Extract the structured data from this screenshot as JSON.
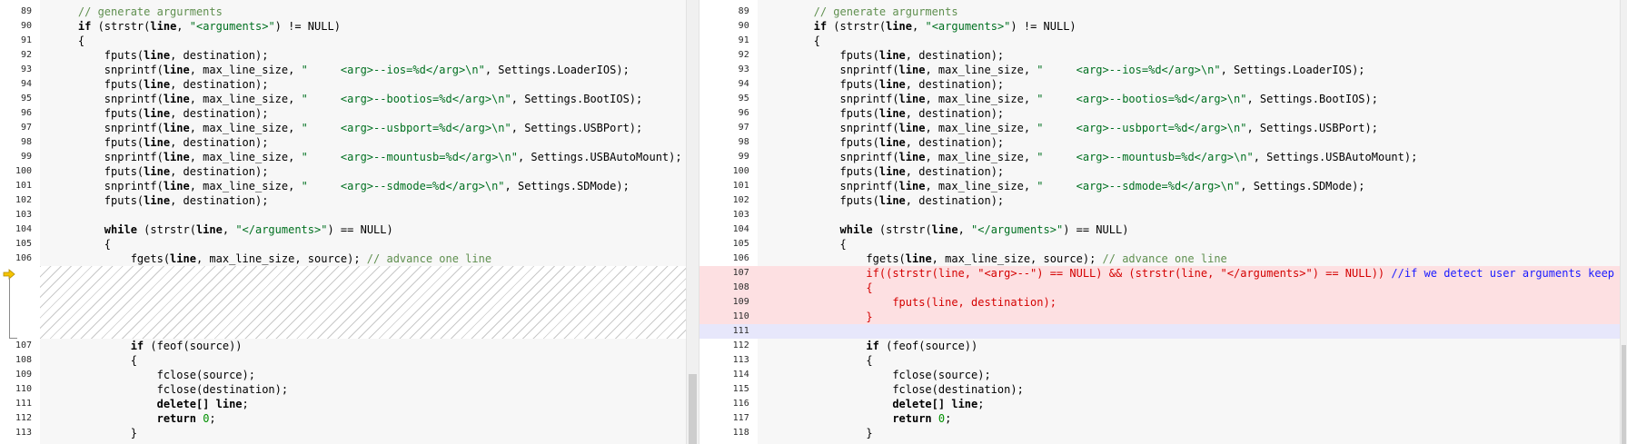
{
  "left": {
    "lines_top": [
      {
        "n": "89",
        "segs": [
          [
            "c",
            "    // generate argurments"
          ]
        ]
      },
      {
        "n": "90",
        "segs": [
          [
            "b",
            "    if"
          ],
          [
            "p",
            " (strstr("
          ],
          [
            "b",
            "line"
          ],
          [
            "p",
            ", "
          ],
          [
            "s",
            "\"<arguments>\""
          ],
          [
            "p",
            ") != NULL)"
          ]
        ]
      },
      {
        "n": "91",
        "segs": [
          [
            "p",
            "    {"
          ]
        ]
      },
      {
        "n": "92",
        "segs": [
          [
            "p",
            "        fputs("
          ],
          [
            "b",
            "line"
          ],
          [
            "p",
            ", destination);"
          ]
        ]
      },
      {
        "n": "93",
        "segs": [
          [
            "p",
            "        snprintf("
          ],
          [
            "b",
            "line"
          ],
          [
            "p",
            ", max_line_size, "
          ],
          [
            "s",
            "\"     <arg>--ios=%d</arg>\\n\""
          ],
          [
            "p",
            ", Settings.LoaderIOS);"
          ]
        ]
      },
      {
        "n": "94",
        "segs": [
          [
            "p",
            "        fputs("
          ],
          [
            "b",
            "line"
          ],
          [
            "p",
            ", destination);"
          ]
        ]
      },
      {
        "n": "95",
        "segs": [
          [
            "p",
            "        snprintf("
          ],
          [
            "b",
            "line"
          ],
          [
            "p",
            ", max_line_size, "
          ],
          [
            "s",
            "\"     <arg>--bootios=%d</arg>\\n\""
          ],
          [
            "p",
            ", Settings.BootIOS);"
          ]
        ]
      },
      {
        "n": "96",
        "segs": [
          [
            "p",
            "        fputs("
          ],
          [
            "b",
            "line"
          ],
          [
            "p",
            ", destination);"
          ]
        ]
      },
      {
        "n": "97",
        "segs": [
          [
            "p",
            "        snprintf("
          ],
          [
            "b",
            "line"
          ],
          [
            "p",
            ", max_line_size, "
          ],
          [
            "s",
            "\"     <arg>--usbport=%d</arg>\\n\""
          ],
          [
            "p",
            ", Settings.USBPort);"
          ]
        ]
      },
      {
        "n": "98",
        "segs": [
          [
            "p",
            "        fputs("
          ],
          [
            "b",
            "line"
          ],
          [
            "p",
            ", destination);"
          ]
        ]
      },
      {
        "n": "99",
        "segs": [
          [
            "p",
            "        snprintf("
          ],
          [
            "b",
            "line"
          ],
          [
            "p",
            ", max_line_size, "
          ],
          [
            "s",
            "\"     <arg>--mountusb=%d</arg>\\n\""
          ],
          [
            "p",
            ", Settings.USBAutoMount);"
          ]
        ]
      },
      {
        "n": "100",
        "segs": [
          [
            "p",
            "        fputs("
          ],
          [
            "b",
            "line"
          ],
          [
            "p",
            ", destination);"
          ]
        ]
      },
      {
        "n": "101",
        "segs": [
          [
            "p",
            "        snprintf("
          ],
          [
            "b",
            "line"
          ],
          [
            "p",
            ", max_line_size, "
          ],
          [
            "s",
            "\"     <arg>--sdmode=%d</arg>\\n\""
          ],
          [
            "p",
            ", Settings.SDMode);"
          ]
        ]
      },
      {
        "n": "102",
        "segs": [
          [
            "p",
            "        fputs("
          ],
          [
            "b",
            "line"
          ],
          [
            "p",
            ", destination);"
          ]
        ]
      },
      {
        "n": "103",
        "segs": [
          [
            "p",
            ""
          ]
        ]
      },
      {
        "n": "104",
        "segs": [
          [
            "b",
            "        while"
          ],
          [
            "p",
            " (strstr("
          ],
          [
            "b",
            "line"
          ],
          [
            "p",
            ", "
          ],
          [
            "s",
            "\"</arguments>\""
          ],
          [
            "p",
            ") == NULL)"
          ]
        ]
      },
      {
        "n": "105",
        "segs": [
          [
            "p",
            "        {"
          ]
        ]
      },
      {
        "n": "106",
        "segs": [
          [
            "p",
            "            fgets("
          ],
          [
            "b",
            "line"
          ],
          [
            "p",
            ", max_line_size, source); "
          ],
          [
            "c",
            "// advance one line"
          ]
        ]
      }
    ],
    "lines_bottom": [
      {
        "n": "107",
        "segs": [
          [
            "b",
            "            if"
          ],
          [
            "p",
            " (feof(source))"
          ]
        ]
      },
      {
        "n": "108",
        "segs": [
          [
            "p",
            "            {"
          ]
        ]
      },
      {
        "n": "109",
        "segs": [
          [
            "p",
            "                fclose(source);"
          ]
        ]
      },
      {
        "n": "110",
        "segs": [
          [
            "p",
            "                fclose(destination);"
          ]
        ]
      },
      {
        "n": "111",
        "segs": [
          [
            "b",
            "                delete[]"
          ],
          [
            "p",
            " "
          ],
          [
            "b",
            "line"
          ],
          [
            "p",
            ";"
          ]
        ]
      },
      {
        "n": "112",
        "segs": [
          [
            "b",
            "                return"
          ],
          [
            "p",
            " "
          ],
          [
            "n",
            "0"
          ],
          [
            "p",
            ";"
          ]
        ]
      },
      {
        "n": "113",
        "segs": [
          [
            "p",
            "            }"
          ]
        ]
      }
    ]
  },
  "right": {
    "lines_top": [
      {
        "n": "89",
        "segs": [
          [
            "c",
            "    // generate argurments"
          ]
        ]
      },
      {
        "n": "90",
        "segs": [
          [
            "b",
            "    if"
          ],
          [
            "p",
            " (strstr("
          ],
          [
            "b",
            "line"
          ],
          [
            "p",
            ", "
          ],
          [
            "s",
            "\"<arguments>\""
          ],
          [
            "p",
            ") != NULL)"
          ]
        ]
      },
      {
        "n": "91",
        "segs": [
          [
            "p",
            "    {"
          ]
        ]
      },
      {
        "n": "92",
        "segs": [
          [
            "p",
            "        fputs("
          ],
          [
            "b",
            "line"
          ],
          [
            "p",
            ", destination);"
          ]
        ]
      },
      {
        "n": "93",
        "segs": [
          [
            "p",
            "        snprintf("
          ],
          [
            "b",
            "line"
          ],
          [
            "p",
            ", max_line_size, "
          ],
          [
            "s",
            "\"     <arg>--ios=%d</arg>\\n\""
          ],
          [
            "p",
            ", Settings.LoaderIOS);"
          ]
        ]
      },
      {
        "n": "94",
        "segs": [
          [
            "p",
            "        fputs("
          ],
          [
            "b",
            "line"
          ],
          [
            "p",
            ", destination);"
          ]
        ]
      },
      {
        "n": "95",
        "segs": [
          [
            "p",
            "        snprintf("
          ],
          [
            "b",
            "line"
          ],
          [
            "p",
            ", max_line_size, "
          ],
          [
            "s",
            "\"     <arg>--bootios=%d</arg>\\n\""
          ],
          [
            "p",
            ", Settings.BootIOS);"
          ]
        ]
      },
      {
        "n": "96",
        "segs": [
          [
            "p",
            "        fputs("
          ],
          [
            "b",
            "line"
          ],
          [
            "p",
            ", destination);"
          ]
        ]
      },
      {
        "n": "97",
        "segs": [
          [
            "p",
            "        snprintf("
          ],
          [
            "b",
            "line"
          ],
          [
            "p",
            ", max_line_size, "
          ],
          [
            "s",
            "\"     <arg>--usbport=%d</arg>\\n\""
          ],
          [
            "p",
            ", Settings.USBPort);"
          ]
        ]
      },
      {
        "n": "98",
        "segs": [
          [
            "p",
            "        fputs("
          ],
          [
            "b",
            "line"
          ],
          [
            "p",
            ", destination);"
          ]
        ]
      },
      {
        "n": "99",
        "segs": [
          [
            "p",
            "        snprintf("
          ],
          [
            "b",
            "line"
          ],
          [
            "p",
            ", max_line_size, "
          ],
          [
            "s",
            "\"     <arg>--mountusb=%d</arg>\\n\""
          ],
          [
            "p",
            ", Settings.USBAutoMount);"
          ]
        ]
      },
      {
        "n": "100",
        "segs": [
          [
            "p",
            "        fputs("
          ],
          [
            "b",
            "line"
          ],
          [
            "p",
            ", destination);"
          ]
        ]
      },
      {
        "n": "101",
        "segs": [
          [
            "p",
            "        snprintf("
          ],
          [
            "b",
            "line"
          ],
          [
            "p",
            ", max_line_size, "
          ],
          [
            "s",
            "\"     <arg>--sdmode=%d</arg>\\n\""
          ],
          [
            "p",
            ", Settings.SDMode);"
          ]
        ]
      },
      {
        "n": "102",
        "segs": [
          [
            "p",
            "        fputs("
          ],
          [
            "b",
            "line"
          ],
          [
            "p",
            ", destination);"
          ]
        ]
      },
      {
        "n": "103",
        "segs": [
          [
            "p",
            ""
          ]
        ]
      },
      {
        "n": "104",
        "segs": [
          [
            "b",
            "        while"
          ],
          [
            "p",
            " (strstr("
          ],
          [
            "b",
            "line"
          ],
          [
            "p",
            ", "
          ],
          [
            "s",
            "\"</arguments>\""
          ],
          [
            "p",
            ") == NULL)"
          ]
        ]
      },
      {
        "n": "105",
        "segs": [
          [
            "p",
            "        {"
          ]
        ]
      },
      {
        "n": "106",
        "segs": [
          [
            "p",
            "            fgets("
          ],
          [
            "b",
            "line"
          ],
          [
            "p",
            ", max_line_size, source); "
          ],
          [
            "c",
            "// advance one line"
          ]
        ]
      }
    ],
    "lines_added": [
      {
        "n": "107",
        "segs": [
          [
            "r",
            "            if((strstr(line, \"<arg>--\") == NULL) && (strstr(line, \"</arguments>\") == NULL)) "
          ],
          [
            "u",
            "//if we detect user arguments keep them"
          ]
        ]
      },
      {
        "n": "108",
        "segs": [
          [
            "r",
            "            {"
          ]
        ]
      },
      {
        "n": "109",
        "segs": [
          [
            "r",
            "                fputs(line, destination);"
          ]
        ]
      },
      {
        "n": "110",
        "segs": [
          [
            "r",
            "            }"
          ]
        ]
      }
    ],
    "line_empty_added": {
      "n": "111"
    },
    "lines_bottom": [
      {
        "n": "112",
        "segs": [
          [
            "b",
            "            if"
          ],
          [
            "p",
            " (feof(source))"
          ]
        ]
      },
      {
        "n": "113",
        "segs": [
          [
            "p",
            "            {"
          ]
        ]
      },
      {
        "n": "114",
        "segs": [
          [
            "p",
            "                fclose(source);"
          ]
        ]
      },
      {
        "n": "115",
        "segs": [
          [
            "p",
            "                fclose(destination);"
          ]
        ]
      },
      {
        "n": "116",
        "segs": [
          [
            "b",
            "                delete[]"
          ],
          [
            "p",
            " "
          ],
          [
            "b",
            "line"
          ],
          [
            "p",
            ";"
          ]
        ]
      },
      {
        "n": "117",
        "segs": [
          [
            "b",
            "                return"
          ],
          [
            "p",
            " "
          ],
          [
            "n",
            "0"
          ],
          [
            "p",
            ";"
          ]
        ]
      },
      {
        "n": "118",
        "segs": [
          [
            "p",
            "            }"
          ]
        ]
      }
    ]
  },
  "icons": {
    "diff_arrow": "arrow-right-icon",
    "arrow_color": "#f5c400"
  }
}
